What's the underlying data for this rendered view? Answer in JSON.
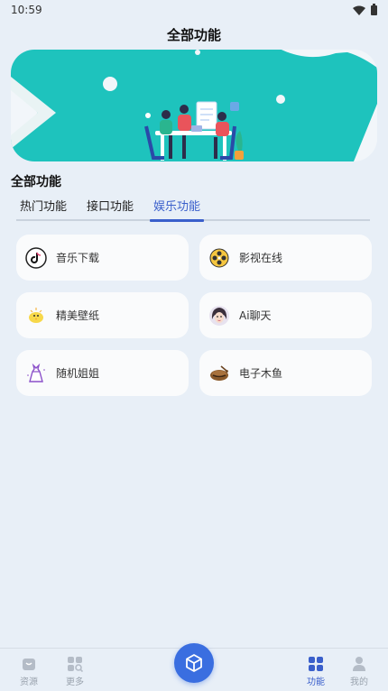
{
  "status_bar": {
    "time": "10:59"
  },
  "header": {
    "title": "全部功能"
  },
  "section": {
    "title": "全部功能"
  },
  "tabs": [
    {
      "label": "热门功能",
      "active": false
    },
    {
      "label": "接口功能",
      "active": false
    },
    {
      "label": "娱乐功能",
      "active": true
    }
  ],
  "features": [
    {
      "label": "音乐下载",
      "icon": "tiktok-music-icon"
    },
    {
      "label": "影视在线",
      "icon": "film-reel-icon"
    },
    {
      "label": "精美壁纸",
      "icon": "chick-wallpaper-icon"
    },
    {
      "label": "Ai聊天",
      "icon": "girl-avatar-icon"
    },
    {
      "label": "随机姐姐",
      "icon": "dress-icon"
    },
    {
      "label": "电子木鱼",
      "icon": "wooden-fish-icon"
    }
  ],
  "bottom_nav": {
    "items": [
      {
        "label": "资源",
        "icon": "resource-bag-icon"
      },
      {
        "label": "更多",
        "icon": "grid-search-icon"
      },
      {
        "label": "功能",
        "icon": "apps-grid-icon",
        "active": true
      },
      {
        "label": "我的",
        "icon": "user-icon"
      }
    ],
    "center_icon": "cube-icon"
  },
  "colors": {
    "accent": "#3a5fcb",
    "banner_teal": "#1ec3bd",
    "fab": "#3a6ee0"
  }
}
